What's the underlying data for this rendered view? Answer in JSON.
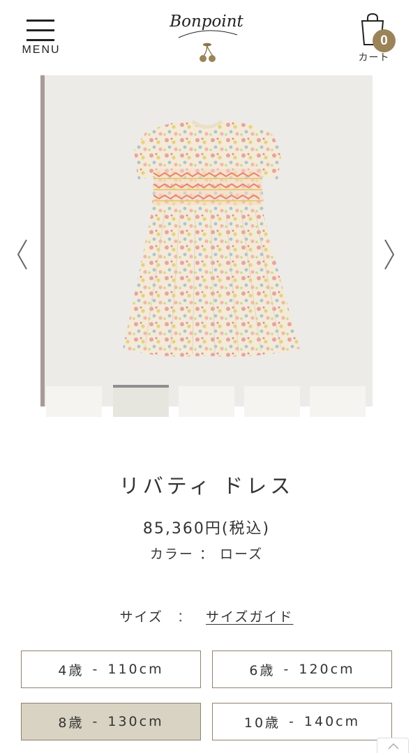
{
  "header": {
    "menu_label": "MENU",
    "logo_text": "Bonpoint",
    "cart_label": "カート",
    "cart_count": "0"
  },
  "gallery": {
    "thumbnail_count": 5,
    "active_thumbnail": 2
  },
  "product": {
    "name": "リバティ ドレス",
    "price": "85,360円(税込)",
    "color_label": "カラー",
    "color_separator": "：",
    "color_value": "ローズ",
    "size_label": "サイズ",
    "size_separator": "：",
    "size_guide_link": "サイズガイド"
  },
  "sizes": [
    {
      "age": "4歳",
      "height": "110cm",
      "selected": false
    },
    {
      "age": "6歳",
      "height": "120cm",
      "selected": false
    },
    {
      "age": "8歳",
      "height": "130cm",
      "selected": true
    },
    {
      "age": "10歳",
      "height": "140cm",
      "selected": false
    }
  ],
  "colors": {
    "accent": "#9a8458",
    "selected_size_bg": "#d8d3c2",
    "button_border": "#8f8070"
  }
}
